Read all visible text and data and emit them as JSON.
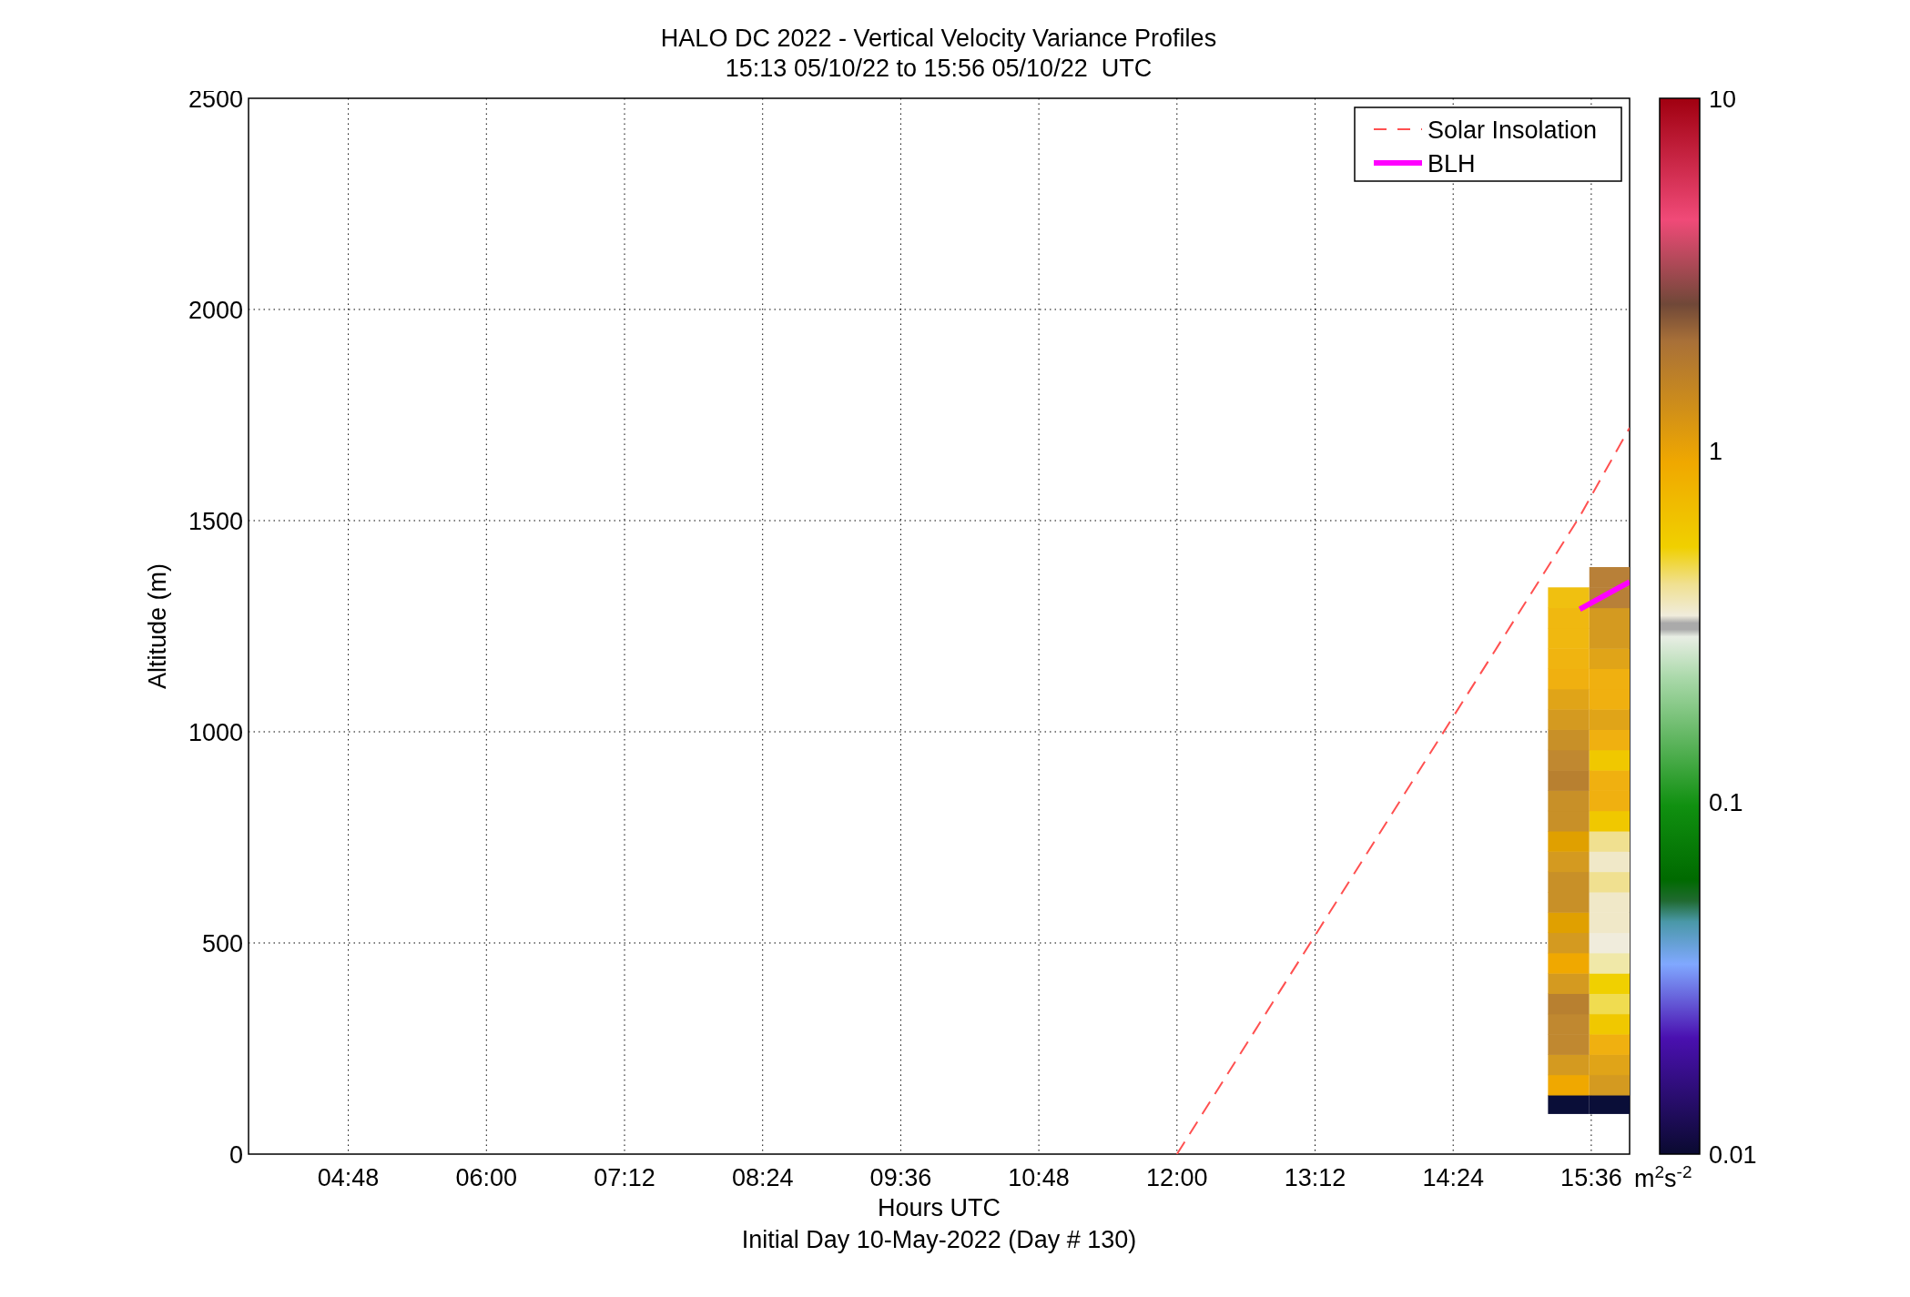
{
  "chart_data": {
    "type": "line",
    "title": "HALO DC 2022 - Vertical Velocity Variance Profiles",
    "grid": true,
    "legend": true,
    "xlabel": "Hours UTC",
    "ylabel": "Altitude (m)",
    "x": [
      12,
      15.5,
      15.933
    ],
    "series": [
      {
        "name": "Solar Insolation",
        "color": "#ff5050",
        "line_style": "dashed",
        "values": [
          0,
          1510,
          1720
        ]
      },
      {
        "name": "BLH",
        "color": "#ff00ff",
        "line_style": "solid",
        "values": [
          null,
          1290,
          1355
        ]
      }
    ],
    "xlim": [
      3.933,
      15.933
    ],
    "ylim": [
      0,
      2500
    ],
    "xticks": [
      {
        "value": 4.8,
        "label": "04:48"
      },
      {
        "value": 6,
        "label": "06:00"
      },
      {
        "value": 7.2,
        "label": "07:12"
      },
      {
        "value": 8.4,
        "label": "08:24"
      },
      {
        "value": 9.6,
        "label": "09:36"
      },
      {
        "value": 10.8,
        "label": "10:48"
      },
      {
        "value": 12,
        "label": "12:00"
      },
      {
        "value": 13.2,
        "label": "13:12"
      },
      {
        "value": 14.4,
        "label": "14:24"
      },
      {
        "value": 15.6,
        "label": "15:36"
      }
    ],
    "yticks": [
      0,
      500,
      1000,
      1500,
      2000,
      2500
    ]
  },
  "time_range": "15:13 05/10/22 to 15:56 05/10/22  UTC",
  "subtitle": "Initial Day 10-May-2022 (Day # 130)",
  "colorbar": {
    "ticks": [
      "10",
      "1",
      "0.1",
      "0.01"
    ],
    "unit": "m$^{2}$s$^{-2}$"
  }
}
